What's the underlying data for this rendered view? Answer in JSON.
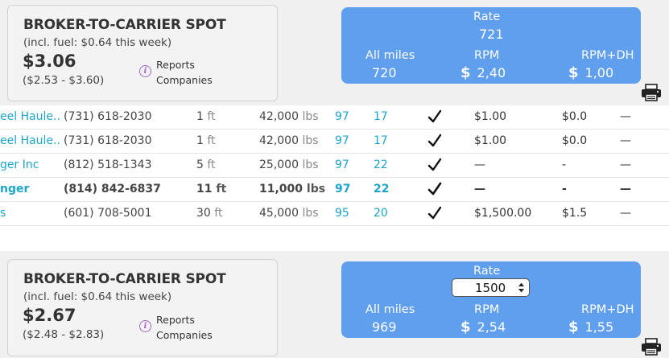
{
  "cards": [
    {
      "title": "BROKER-TO-CARRIER SPOT",
      "fuel": "(incl. fuel: $0.64 this week)",
      "price": "$3.06",
      "range": "($2.53 - $3.60)",
      "reports": "Reports",
      "companies": "Companies",
      "rate_label": "Rate",
      "rate_value": "721",
      "all_miles_label": "All miles",
      "all_miles_value": "720",
      "rpm_label": "RPM",
      "rpm_currency": "$",
      "rpm_value": "2,40",
      "rpmdh_label": "RPM+DH",
      "rpmdh_currency": "$",
      "rpmdh_value": "1,00"
    },
    {
      "title": "BROKER-TO-CARRIER SPOT",
      "fuel": "(incl. fuel: $0.64 this week)",
      "price": "$2.67",
      "range": "($2.48 - $2.83)",
      "reports": "Reports",
      "companies": "Companies",
      "rate_label": "Rate",
      "rate_value": "1500",
      "all_miles_label": "All miles",
      "all_miles_value": "969",
      "rpm_label": "RPM",
      "rpm_currency": "$",
      "rpm_value": "2,54",
      "rpmdh_label": "RPM+DH",
      "rpmdh_currency": "$",
      "rpmdh_value": "1,55"
    }
  ],
  "rows": [
    {
      "name": "eel Haule...",
      "phone": "(731) 618-2030",
      "length": "1",
      "length_unit": "ft",
      "weight": "42,000",
      "weight_unit": "lbs",
      "col_a": "97",
      "col_b": "17",
      "price": "$1.00",
      "rpm": "$0.0",
      "dash": "—",
      "bold": false
    },
    {
      "name": "eel Haule...",
      "phone": "(731) 618-2030",
      "length": "1",
      "length_unit": "ft",
      "weight": "42,000",
      "weight_unit": "lbs",
      "col_a": "97",
      "col_b": "17",
      "price": "$1.00",
      "rpm": "$0.0",
      "dash": "—",
      "bold": false
    },
    {
      "name": "ger Inc",
      "phone": "(812) 518-1343",
      "length": "5",
      "length_unit": "ft",
      "weight": "25,000",
      "weight_unit": "lbs",
      "col_a": "97",
      "col_b": "22",
      "price": "—",
      "rpm": "-",
      "dash": "—",
      "bold": false
    },
    {
      "name": "nger",
      "phone": "(814) 842-6837",
      "length": "11",
      "length_unit": "ft",
      "weight": "11,000",
      "weight_unit": "lbs",
      "col_a": "97",
      "col_b": "22",
      "price": "—",
      "rpm": "-",
      "dash": "—",
      "bold": true
    },
    {
      "name": "s",
      "phone": "(601) 708-5001",
      "length": "30",
      "length_unit": "ft",
      "weight": "45,000",
      "weight_unit": "lbs",
      "col_a": "95",
      "col_b": "20",
      "price": "$1,500.00",
      "rpm": "$1.5",
      "dash": "—",
      "bold": false
    }
  ],
  "icons": {
    "info": "info-icon",
    "printer": "printer-icon",
    "check": "check-icon"
  },
  "colors": {
    "accent_blue": "#5f9fee",
    "link_teal": "#1ea5c9",
    "info_purple": "#a565c9"
  }
}
